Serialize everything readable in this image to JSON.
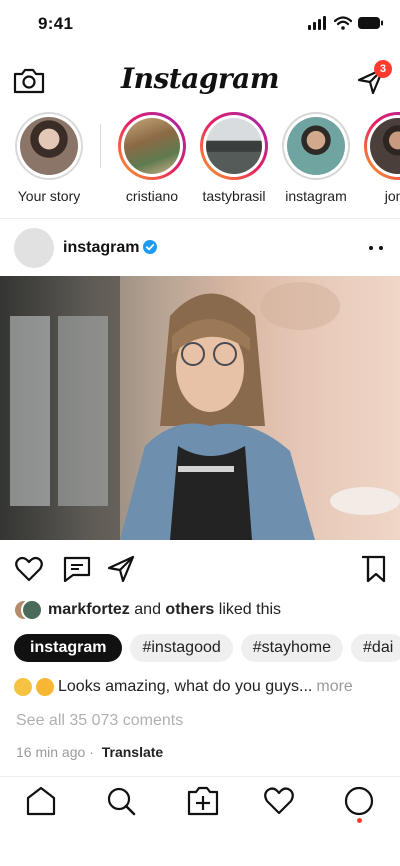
{
  "status": {
    "time": "9:41"
  },
  "header": {
    "brand": "Instagram",
    "notification_count": "3"
  },
  "stories": [
    {
      "name": "Your story",
      "own": true
    },
    {
      "name": "cristiano"
    },
    {
      "name": "tastybrasil"
    },
    {
      "name": "instagram"
    },
    {
      "name": "jonh"
    }
  ],
  "post": {
    "username": "instagram",
    "liked_by_user": "markfortez",
    "liked_and": "and",
    "liked_others": "others",
    "liked_suffix": "liked this",
    "tags": [
      "instagram",
      "#instagood",
      "#stayhome",
      "#dai"
    ],
    "caption": "Looks amazing, what do you guys...",
    "caption_more": "more",
    "comments_link": "See all 35 073 coments",
    "time_ago": "16 min ago",
    "separator": "·",
    "translate": "Translate"
  },
  "colors": {
    "story_gradient": [
      "#f9a825",
      "#e91e63",
      "#9c27b0"
    ],
    "badge": "#ff3b30",
    "verified": "#1d9bf0"
  },
  "icons": {
    "camera": "camera-icon",
    "send": "send-icon",
    "like": "heart-icon",
    "comment": "comment-icon",
    "share": "share-icon",
    "save": "bookmark-icon",
    "home": "home-icon",
    "search": "search-icon",
    "add": "add-post-icon",
    "activity": "heart-icon",
    "profile": "profile-icon"
  }
}
